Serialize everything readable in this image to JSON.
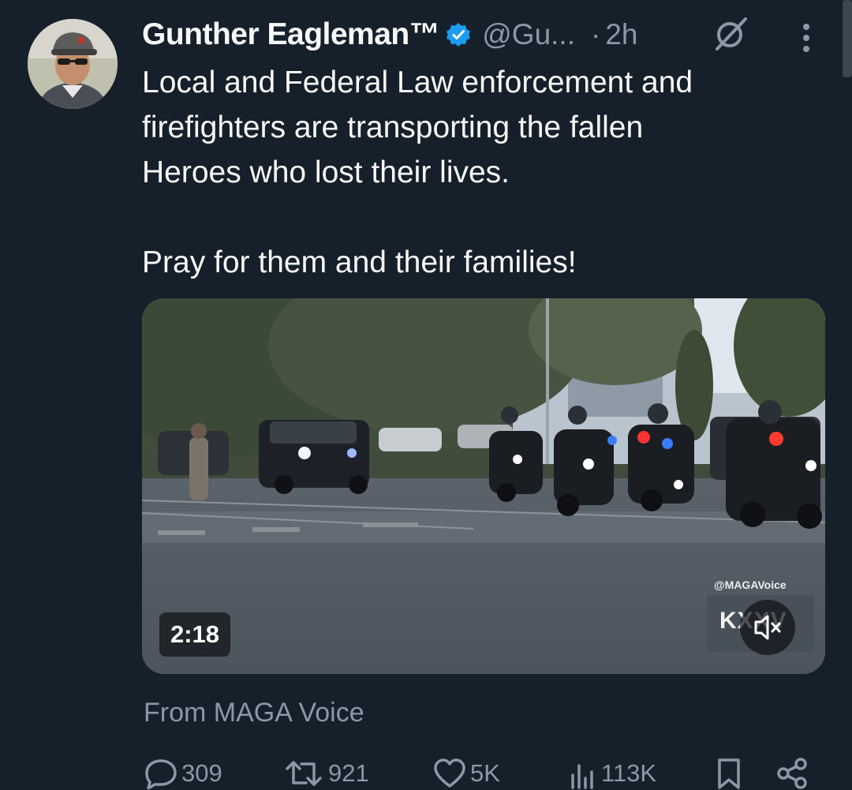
{
  "author": {
    "display_name": "Gunther Eagleman™",
    "handle": "@Gu...",
    "separator": "·",
    "timestamp": "2h",
    "verified": true
  },
  "tweet": {
    "text": "Local and Federal Law enforcement and\nfirefighters are transporting the fallen\nHeroes who lost their lives.\n\nPray for them and their families!"
  },
  "media": {
    "type": "video",
    "duration": "2:18",
    "watermark": "@MAGAVoice",
    "channel_logo_text": "KXXV"
  },
  "source": "From MAGA Voice",
  "metrics": {
    "replies": "309",
    "reposts": "921",
    "likes": "5K",
    "views": "113K"
  },
  "colors": {
    "background": "#15202b",
    "text": "#f7f9f9",
    "muted": "#8b98a5",
    "verified_blue": "#1d9bf0"
  }
}
